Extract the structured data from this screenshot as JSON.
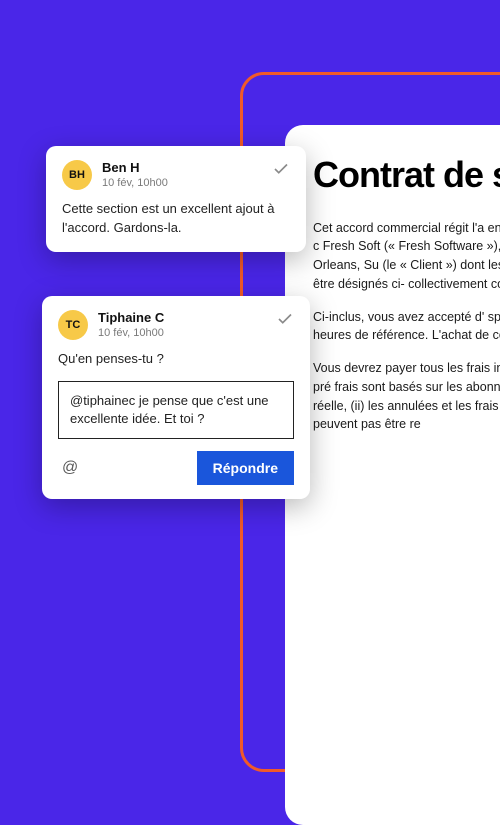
{
  "document": {
    "title": "Contrat de servic",
    "paragraphs": [
      "Cet accord commercial régit l'a entrera en vigueur le [Date de c Fresh Soft (« Fresh Software »), situés au 350 North Orleans, Su (le « Client ») dont les bureaux s Client peuvent être désignés ci- collectivement comme « Parties",
      "Ci-inclus, vous avez accepté d' spécifié ci-dessous. Les heures de référence. L'achat de ces se dessous.",
      "Vous devrez payer tous les frais indication contraire dans les pré frais sont basés sur les abonnem non sur l'utilisation réelle, (ii) les annulées et les frais payés ne se achetées ne peuvent pas être re"
    ]
  },
  "comments": [
    {
      "initials": "BH",
      "author": "Ben H",
      "time": "10 fév, 10h00",
      "body": "Cette section est un excellent ajout à l'accord. Gardons-la."
    },
    {
      "initials": "TC",
      "author": "Tiphaine C",
      "time": "10 fév, 10h00",
      "body": "Qu'en penses-tu ?",
      "reply_draft": "@tiphainec je pense que c'est une excellente idée. Et toi ?"
    }
  ],
  "actions": {
    "mention_label": "@",
    "reply_label": "Répondre"
  }
}
